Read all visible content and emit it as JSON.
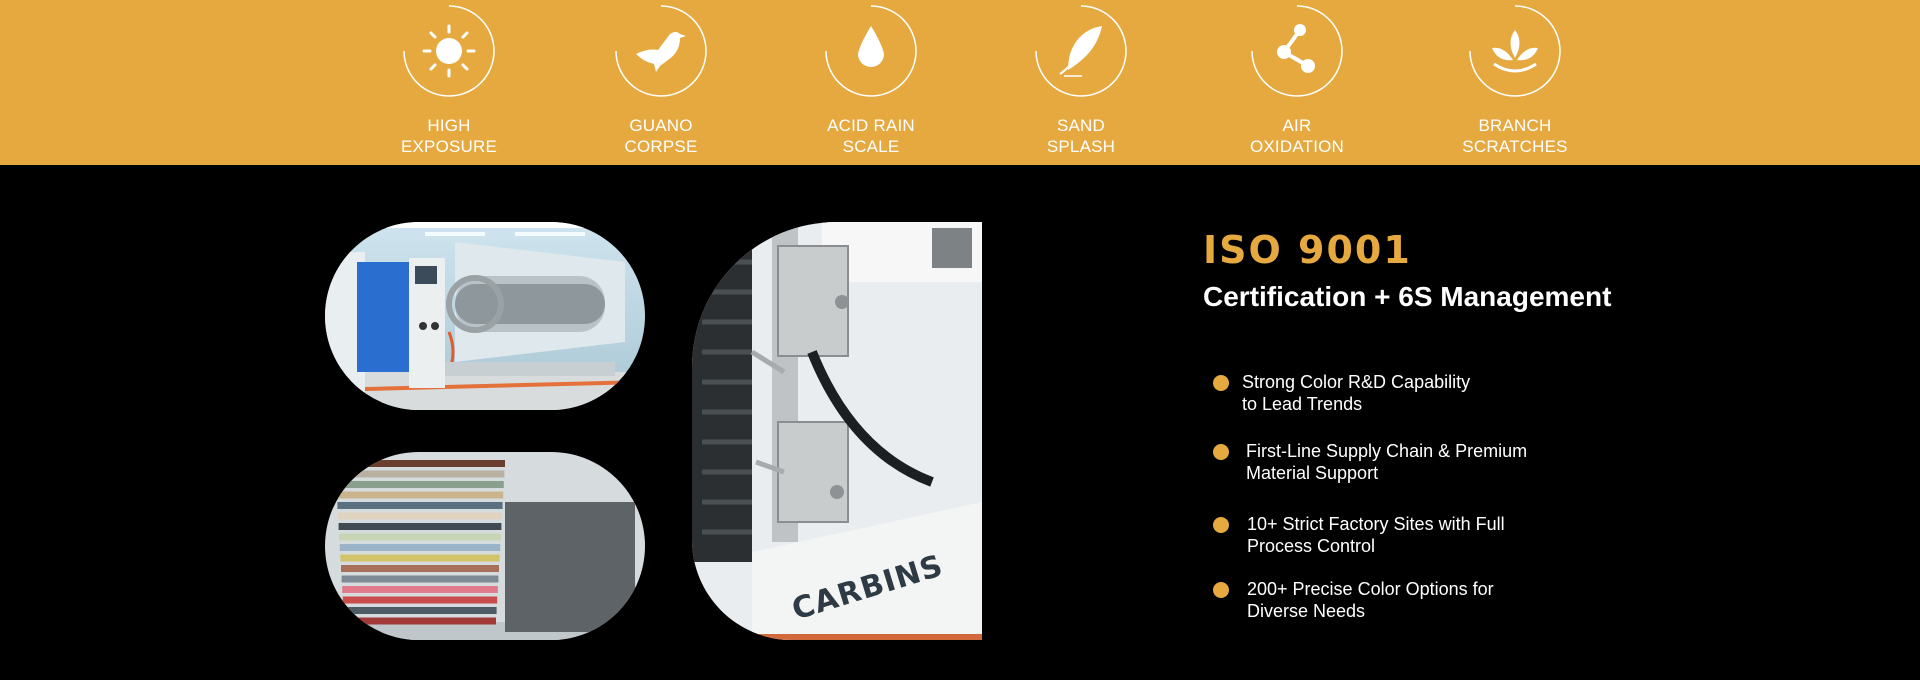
{
  "features": [
    {
      "icon": "sun-icon",
      "lines": [
        "HIGH",
        "EXPOSURE"
      ]
    },
    {
      "icon": "bird-icon",
      "lines": [
        "GUANO",
        "CORPSE"
      ]
    },
    {
      "icon": "droplet-icon",
      "lines": [
        "ACID RAIN",
        "SCALE"
      ]
    },
    {
      "icon": "feather-icon",
      "lines": [
        "SAND",
        "SPLASH"
      ]
    },
    {
      "icon": "share-nodes-icon",
      "lines": [
        "AIR",
        "OXIDATION"
      ]
    },
    {
      "icon": "leaf-sprout-icon",
      "lines": [
        "BRANCH",
        "SCRATCHES"
      ]
    }
  ],
  "iso_title": "ISO 9001",
  "subtitle": "Certification + 6S Management",
  "points": [
    {
      "lines": [
        "Strong Color R&D Capability",
        "to Lead Trends"
      ]
    },
    {
      "lines": [
        "First-Line Supply Chain & Premium",
        "Material Support"
      ]
    },
    {
      "lines": [
        "10+ Strict Factory Sites with Full",
        "Process Control"
      ]
    },
    {
      "lines": [
        "200+ Precise Color Options for",
        "Diverse Needs"
      ]
    }
  ],
  "machine_brand": "CARBINS",
  "colors": {
    "accent": "#e5a940",
    "background": "#000000",
    "text": "#ffffff"
  }
}
